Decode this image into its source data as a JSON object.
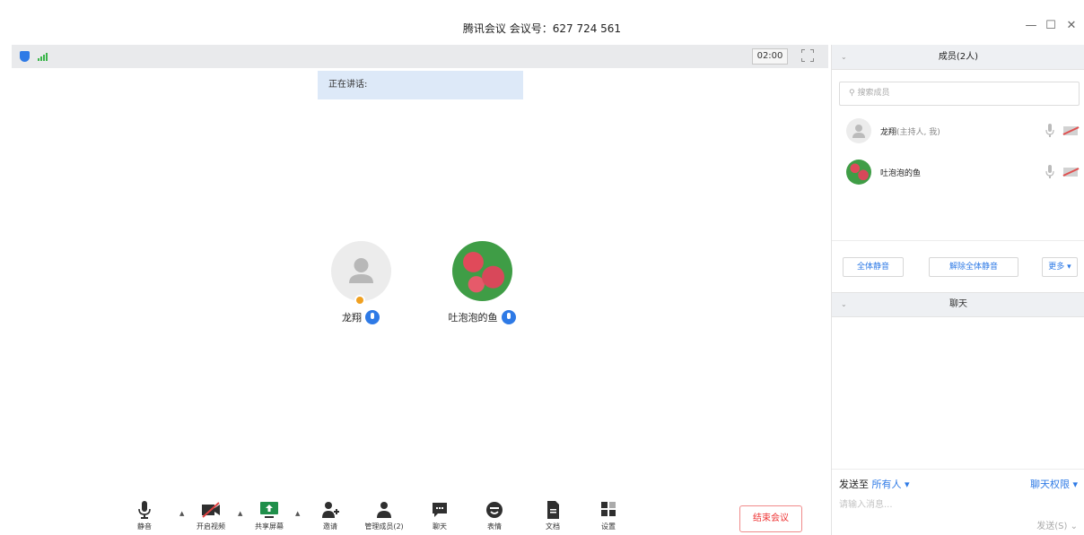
{
  "window": {
    "title": "腾讯会议 会议号：627 724 561",
    "minimize": "—",
    "maximize": "☐",
    "close": "✕"
  },
  "main": {
    "timer": "02:00",
    "speaking_label": "正在讲话:",
    "participants": [
      {
        "name": "龙翔",
        "is_host": true
      },
      {
        "name": "吐泡泡的鱼",
        "is_host": false
      }
    ]
  },
  "toolbar": {
    "mute": "静音",
    "video": "开启视频",
    "share": "共享屏幕",
    "invite": "邀请",
    "members": "管理成员(2)",
    "chat": "聊天",
    "emoji": "表情",
    "docs": "文档",
    "settings": "设置",
    "caret": "▲",
    "end": "结束会议"
  },
  "members_panel": {
    "title": "成员(2人)",
    "chevron": "⌄",
    "search_placeholder": "搜索成员",
    "members": [
      {
        "name": "龙翔",
        "role": "(主持人, 我)"
      },
      {
        "name": "吐泡泡的鱼",
        "role": ""
      }
    ],
    "mute_all": "全体静音",
    "unmute_all": "解除全体静音",
    "more": "更多 ▾"
  },
  "chat_panel": {
    "title": "聊天",
    "chevron": "⌄",
    "send_to_label": "发送至",
    "send_to_target": "所有人 ▾",
    "permission": "聊天权限 ▾",
    "input_placeholder": "请输入消息...",
    "send": "发送(S)  ⌄"
  },
  "colors": {
    "accent": "#2e7ae6",
    "danger": "#e33333",
    "speaking_bg": "#dde9f8"
  }
}
